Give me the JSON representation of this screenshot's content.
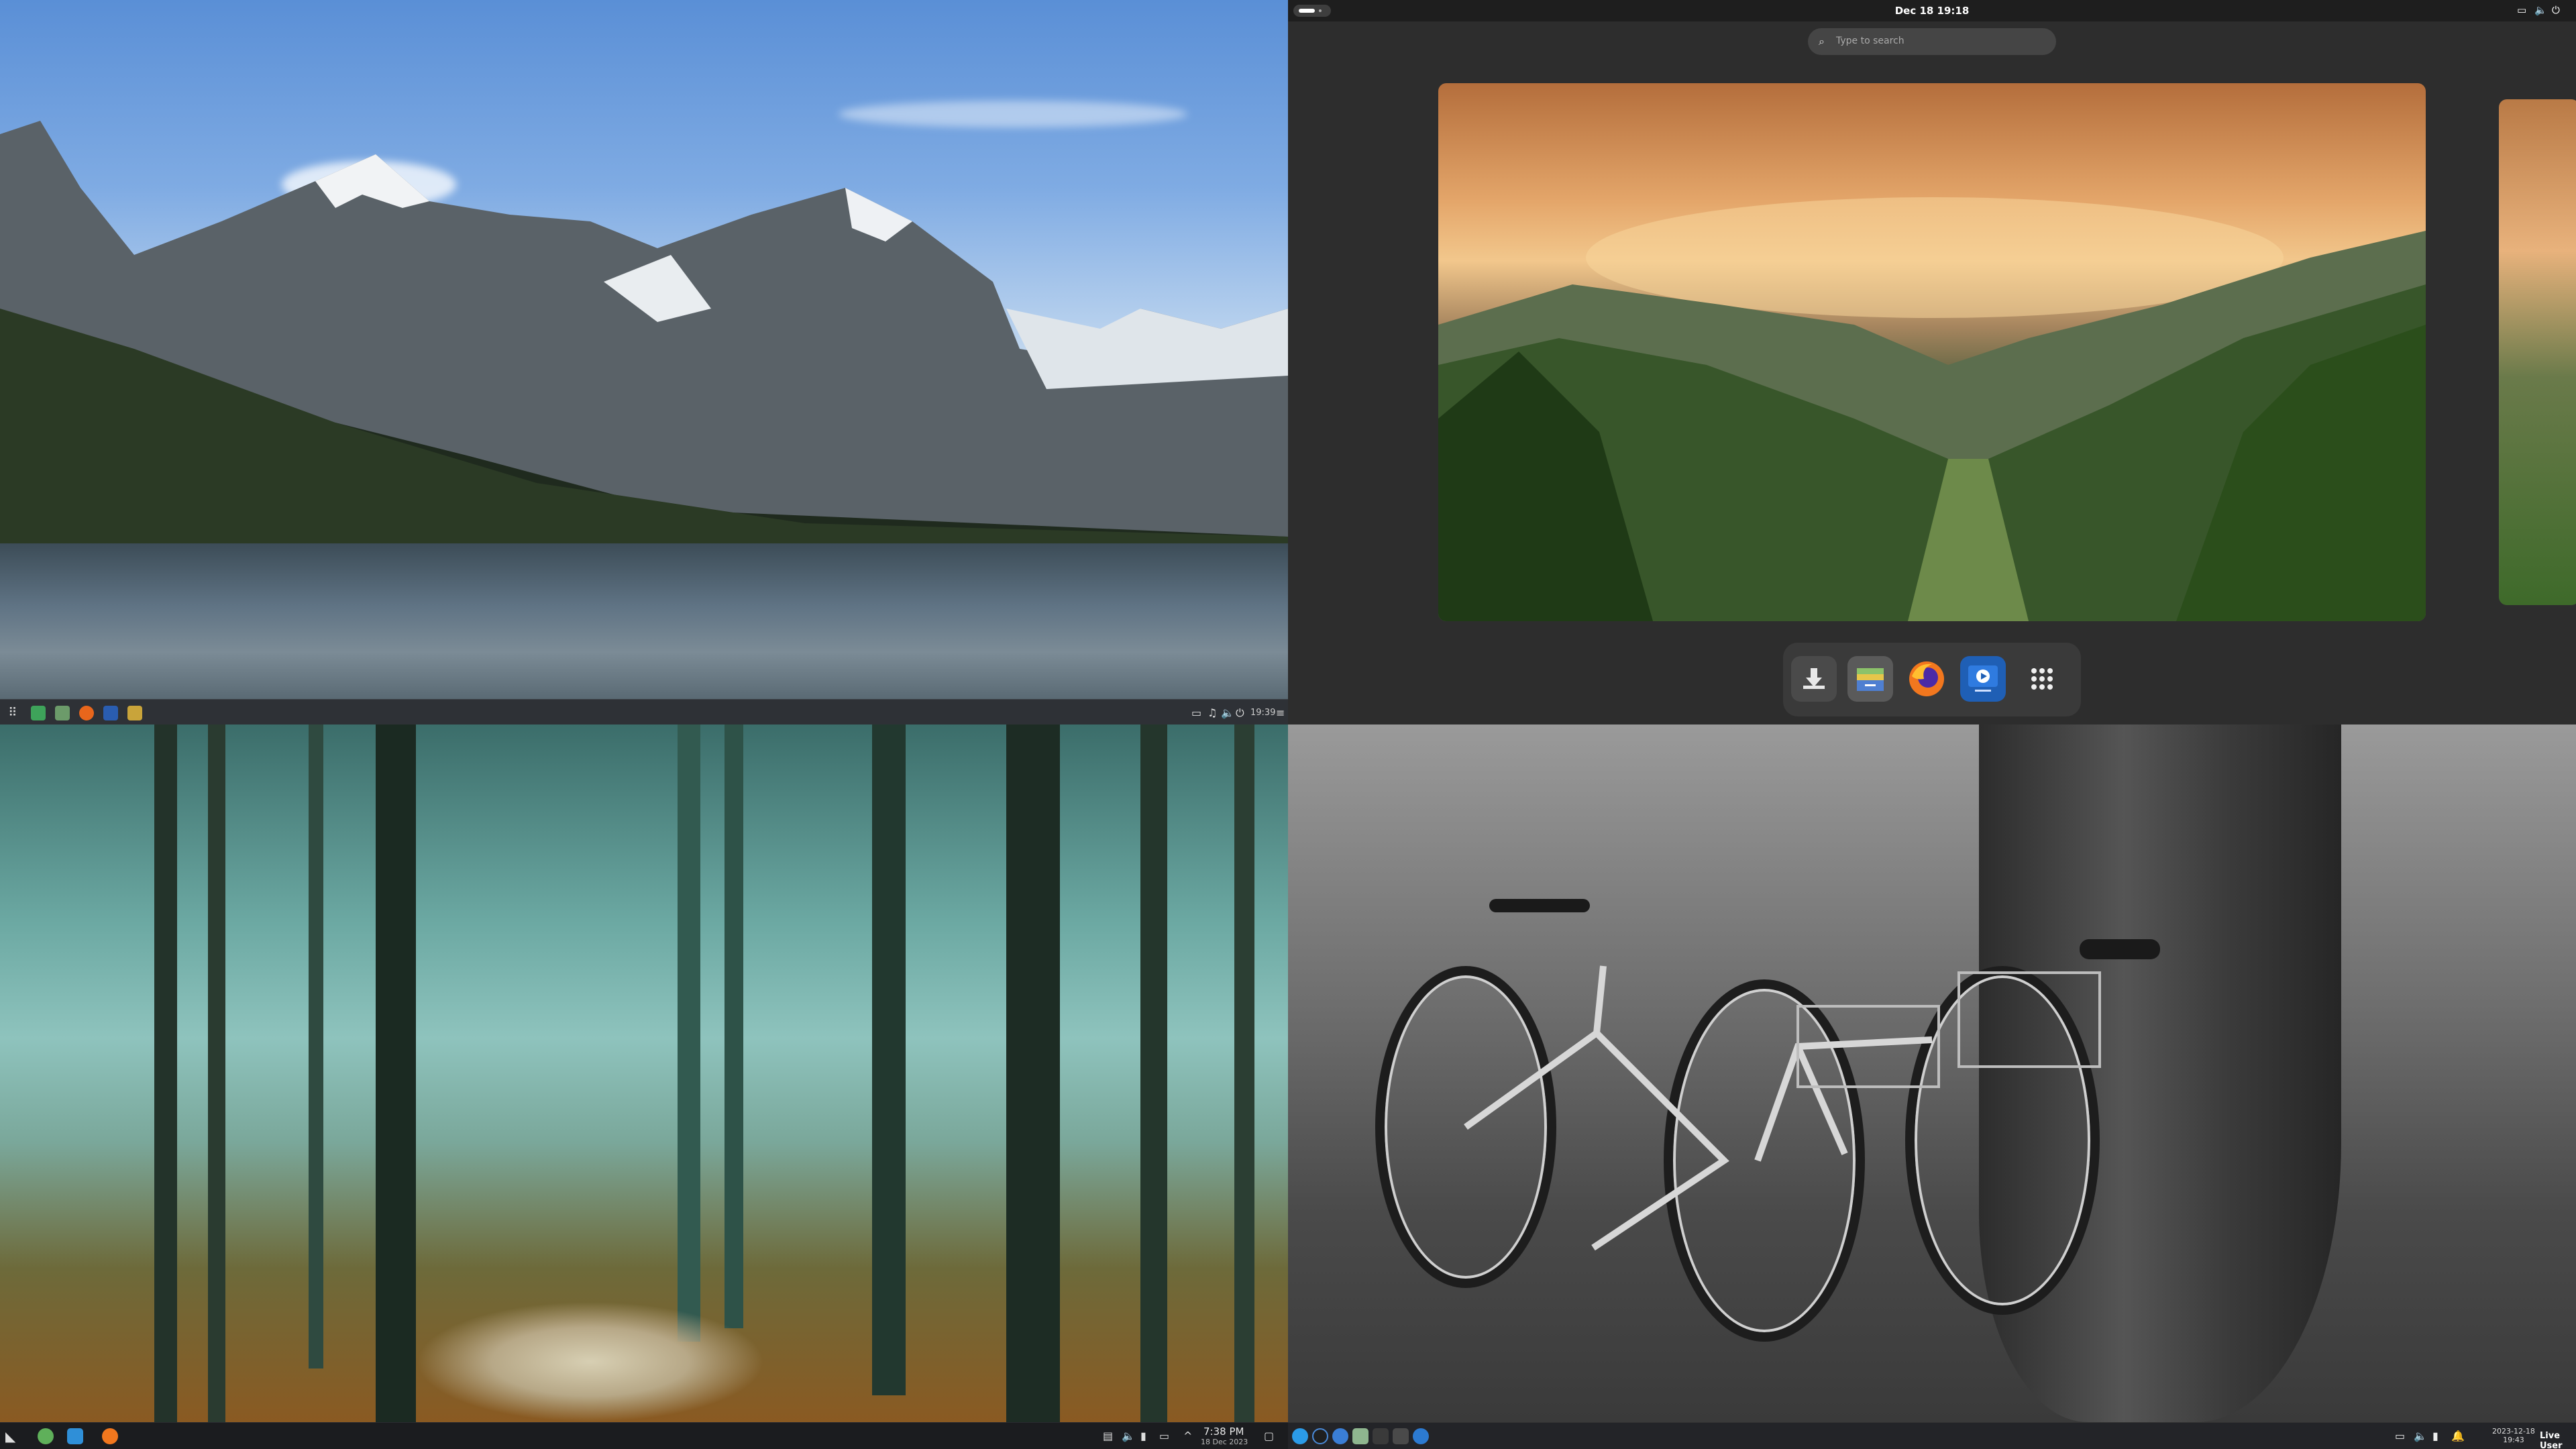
{
  "top_left": {
    "panel": {
      "tray_time": "19:39"
    }
  },
  "top_right": {
    "topbar": {
      "clock": "Dec 18  19:18"
    },
    "search": {
      "placeholder": "Type to search"
    },
    "dash": {
      "items": [
        "download-icon",
        "files-icon",
        "firefox-icon",
        "video-player-icon",
        "app-grid-icon"
      ]
    }
  },
  "bottom_left": {
    "taskbar": {
      "clock_time": "7:38 PM",
      "clock_date": "18 Dec 2023"
    }
  },
  "bottom_right": {
    "taskbar": {
      "clock_date": "2023-12-18",
      "clock_time": "19:43",
      "user": "Live User"
    }
  }
}
